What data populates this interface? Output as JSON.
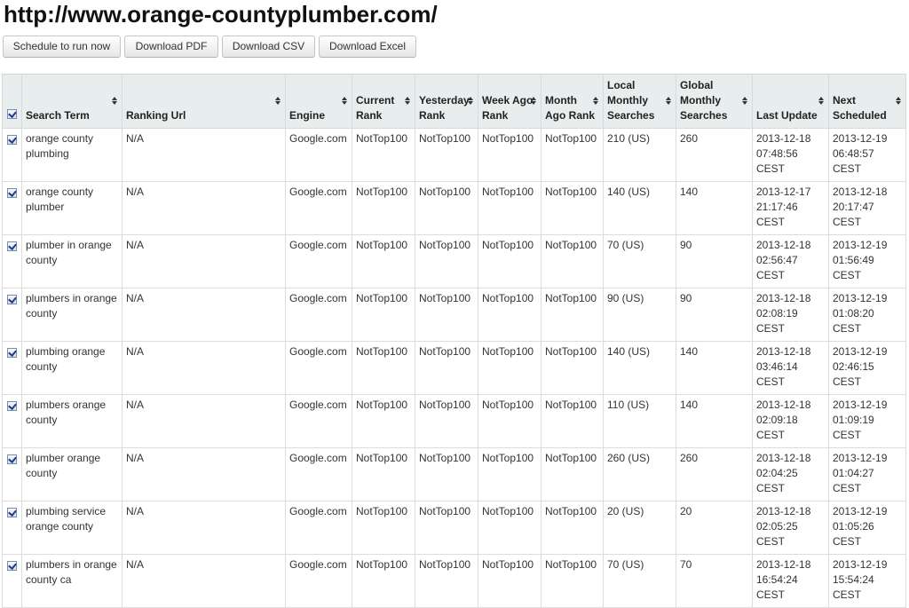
{
  "page": {
    "title": "http://www.orange-countyplumber.com/"
  },
  "toolbar": {
    "schedule_label": "Schedule to run now",
    "pdf_label": "Download PDF",
    "csv_label": "Download CSV",
    "excel_label": "Download Excel"
  },
  "table": {
    "columns": [
      "Search Term",
      "Ranking Url",
      "Engine",
      "Current Rank",
      "Yesterday Rank",
      "Week Ago Rank",
      "Month Ago Rank",
      "Local Monthly Searches",
      "Global Monthly Searches",
      "Last Update",
      "Next Scheduled"
    ],
    "rows": [
      {
        "checked": true,
        "cells": [
          "orange county plumbing",
          "N/A",
          "Google.com",
          "NotTop100",
          "NotTop100",
          "NotTop100",
          "NotTop100",
          "210 (US)",
          "260",
          "2013-12-18 07:48:56 CEST",
          "2013-12-19 06:48:57 CEST"
        ]
      },
      {
        "checked": true,
        "cells": [
          "orange county plumber",
          "N/A",
          "Google.com",
          "NotTop100",
          "NotTop100",
          "NotTop100",
          "NotTop100",
          "140 (US)",
          "140",
          "2013-12-17 21:17:46 CEST",
          "2013-12-18 20:17:47 CEST"
        ]
      },
      {
        "checked": true,
        "cells": [
          "plumber in orange county",
          "N/A",
          "Google.com",
          "NotTop100",
          "NotTop100",
          "NotTop100",
          "NotTop100",
          "70 (US)",
          "90",
          "2013-12-18 02:56:47 CEST",
          "2013-12-19 01:56:49 CEST"
        ]
      },
      {
        "checked": true,
        "cells": [
          "plumbers in orange county",
          "N/A",
          "Google.com",
          "NotTop100",
          "NotTop100",
          "NotTop100",
          "NotTop100",
          "90 (US)",
          "90",
          "2013-12-18 02:08:19 CEST",
          "2013-12-19 01:08:20 CEST"
        ]
      },
      {
        "checked": true,
        "cells": [
          "plumbing orange county",
          "N/A",
          "Google.com",
          "NotTop100",
          "NotTop100",
          "NotTop100",
          "NotTop100",
          "140 (US)",
          "140",
          "2013-12-18 03:46:14 CEST",
          "2013-12-19 02:46:15 CEST"
        ]
      },
      {
        "checked": true,
        "cells": [
          "plumbers orange county",
          "N/A",
          "Google.com",
          "NotTop100",
          "NotTop100",
          "NotTop100",
          "NotTop100",
          "110 (US)",
          "140",
          "2013-12-18 02:09:18 CEST",
          "2013-12-19 01:09:19 CEST"
        ]
      },
      {
        "checked": true,
        "cells": [
          "plumber orange county",
          "N/A",
          "Google.com",
          "NotTop100",
          "NotTop100",
          "NotTop100",
          "NotTop100",
          "260 (US)",
          "260",
          "2013-12-18 02:04:25 CEST",
          "2013-12-19 01:04:27 CEST"
        ]
      },
      {
        "checked": true,
        "cells": [
          "plumbing service orange county",
          "N/A",
          "Google.com",
          "NotTop100",
          "NotTop100",
          "NotTop100",
          "NotTop100",
          "20 (US)",
          "20",
          "2013-12-18 02:05:25 CEST",
          "2013-12-19 01:05:26 CEST"
        ]
      },
      {
        "checked": true,
        "cells": [
          "plumbers in orange county ca",
          "N/A",
          "Google.com",
          "NotTop100",
          "NotTop100",
          "NotTop100",
          "NotTop100",
          "70 (US)",
          "70",
          "2013-12-18 16:54:24 CEST",
          "2013-12-19 15:54:24 CEST"
        ]
      }
    ]
  }
}
